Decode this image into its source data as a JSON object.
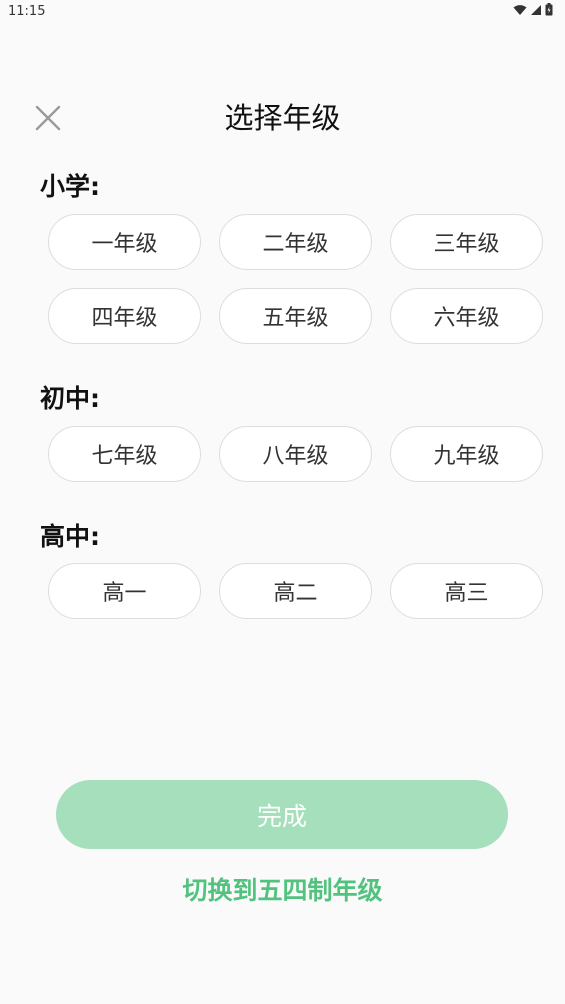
{
  "status_bar": {
    "time": "11:15",
    "icons": [
      "wifi-icon",
      "signal-icon",
      "battery-icon"
    ]
  },
  "header": {
    "title": "选择年级",
    "close_icon": "close-icon"
  },
  "sections": {
    "primary": {
      "title": "小学:",
      "grades": [
        "一年级",
        "二年级",
        "三年级",
        "四年级",
        "五年级",
        "六年级"
      ]
    },
    "junior": {
      "title": "初中:",
      "grades": [
        "七年级",
        "八年级",
        "九年级"
      ]
    },
    "senior": {
      "title": "高中:",
      "grades": [
        "高一",
        "高二",
        "高三"
      ]
    }
  },
  "footer": {
    "done_label": "完成",
    "switch_label": "切换到五四制年级"
  },
  "colors": {
    "done_button": "#a6dfbc",
    "switch_link": "#52c37f",
    "background": "#fafafa"
  }
}
